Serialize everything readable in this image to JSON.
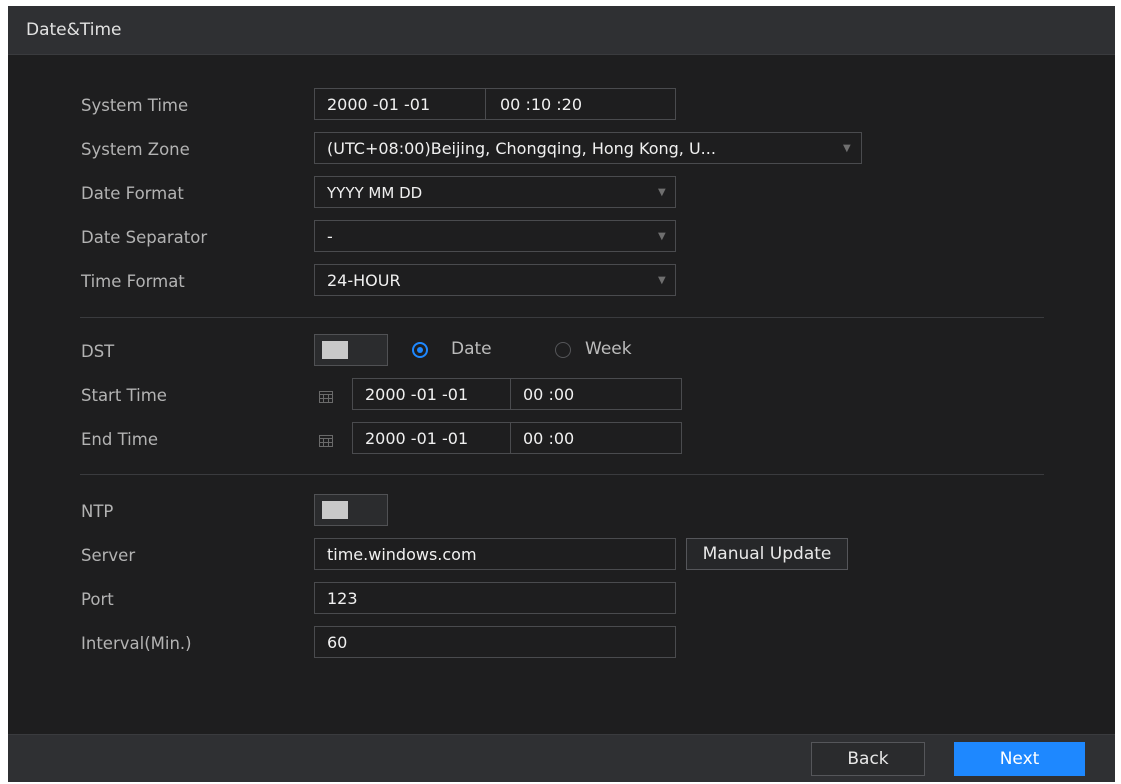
{
  "window": {
    "title": "Date&Time"
  },
  "labels": {
    "system_time": "System Time",
    "system_zone": "System Zone",
    "date_format": "Date Format",
    "date_separator": "Date Separator",
    "time_format": "Time Format",
    "dst": "DST",
    "start_time": "Start Time",
    "end_time": "End Time",
    "ntp": "NTP",
    "server": "Server",
    "port": "Port",
    "interval": "Interval(Min.)"
  },
  "fields": {
    "system_time_date": "2000 -01 -01",
    "system_time_time": "00 :10 :20",
    "system_zone": "(UTC+08:00)Beijing, Chongqing, Hong Kong, U...",
    "date_format": "YYYY MM DD",
    "date_separator": "-",
    "time_format": "24-HOUR",
    "start_date": "2000 -01 -01",
    "start_time": "00 :00",
    "end_date": "2000 -01 -01",
    "end_time": "00 :00",
    "server": "time.windows.com",
    "port": "123",
    "interval": "60"
  },
  "dst": {
    "date_label": "Date",
    "week_label": "Week",
    "selected": "Date"
  },
  "buttons": {
    "manual_update": "Manual Update",
    "back": "Back",
    "next": "Next"
  },
  "colors": {
    "accent": "#1e88ff",
    "background": "#1e1e1f",
    "bar": "#2f3033"
  }
}
